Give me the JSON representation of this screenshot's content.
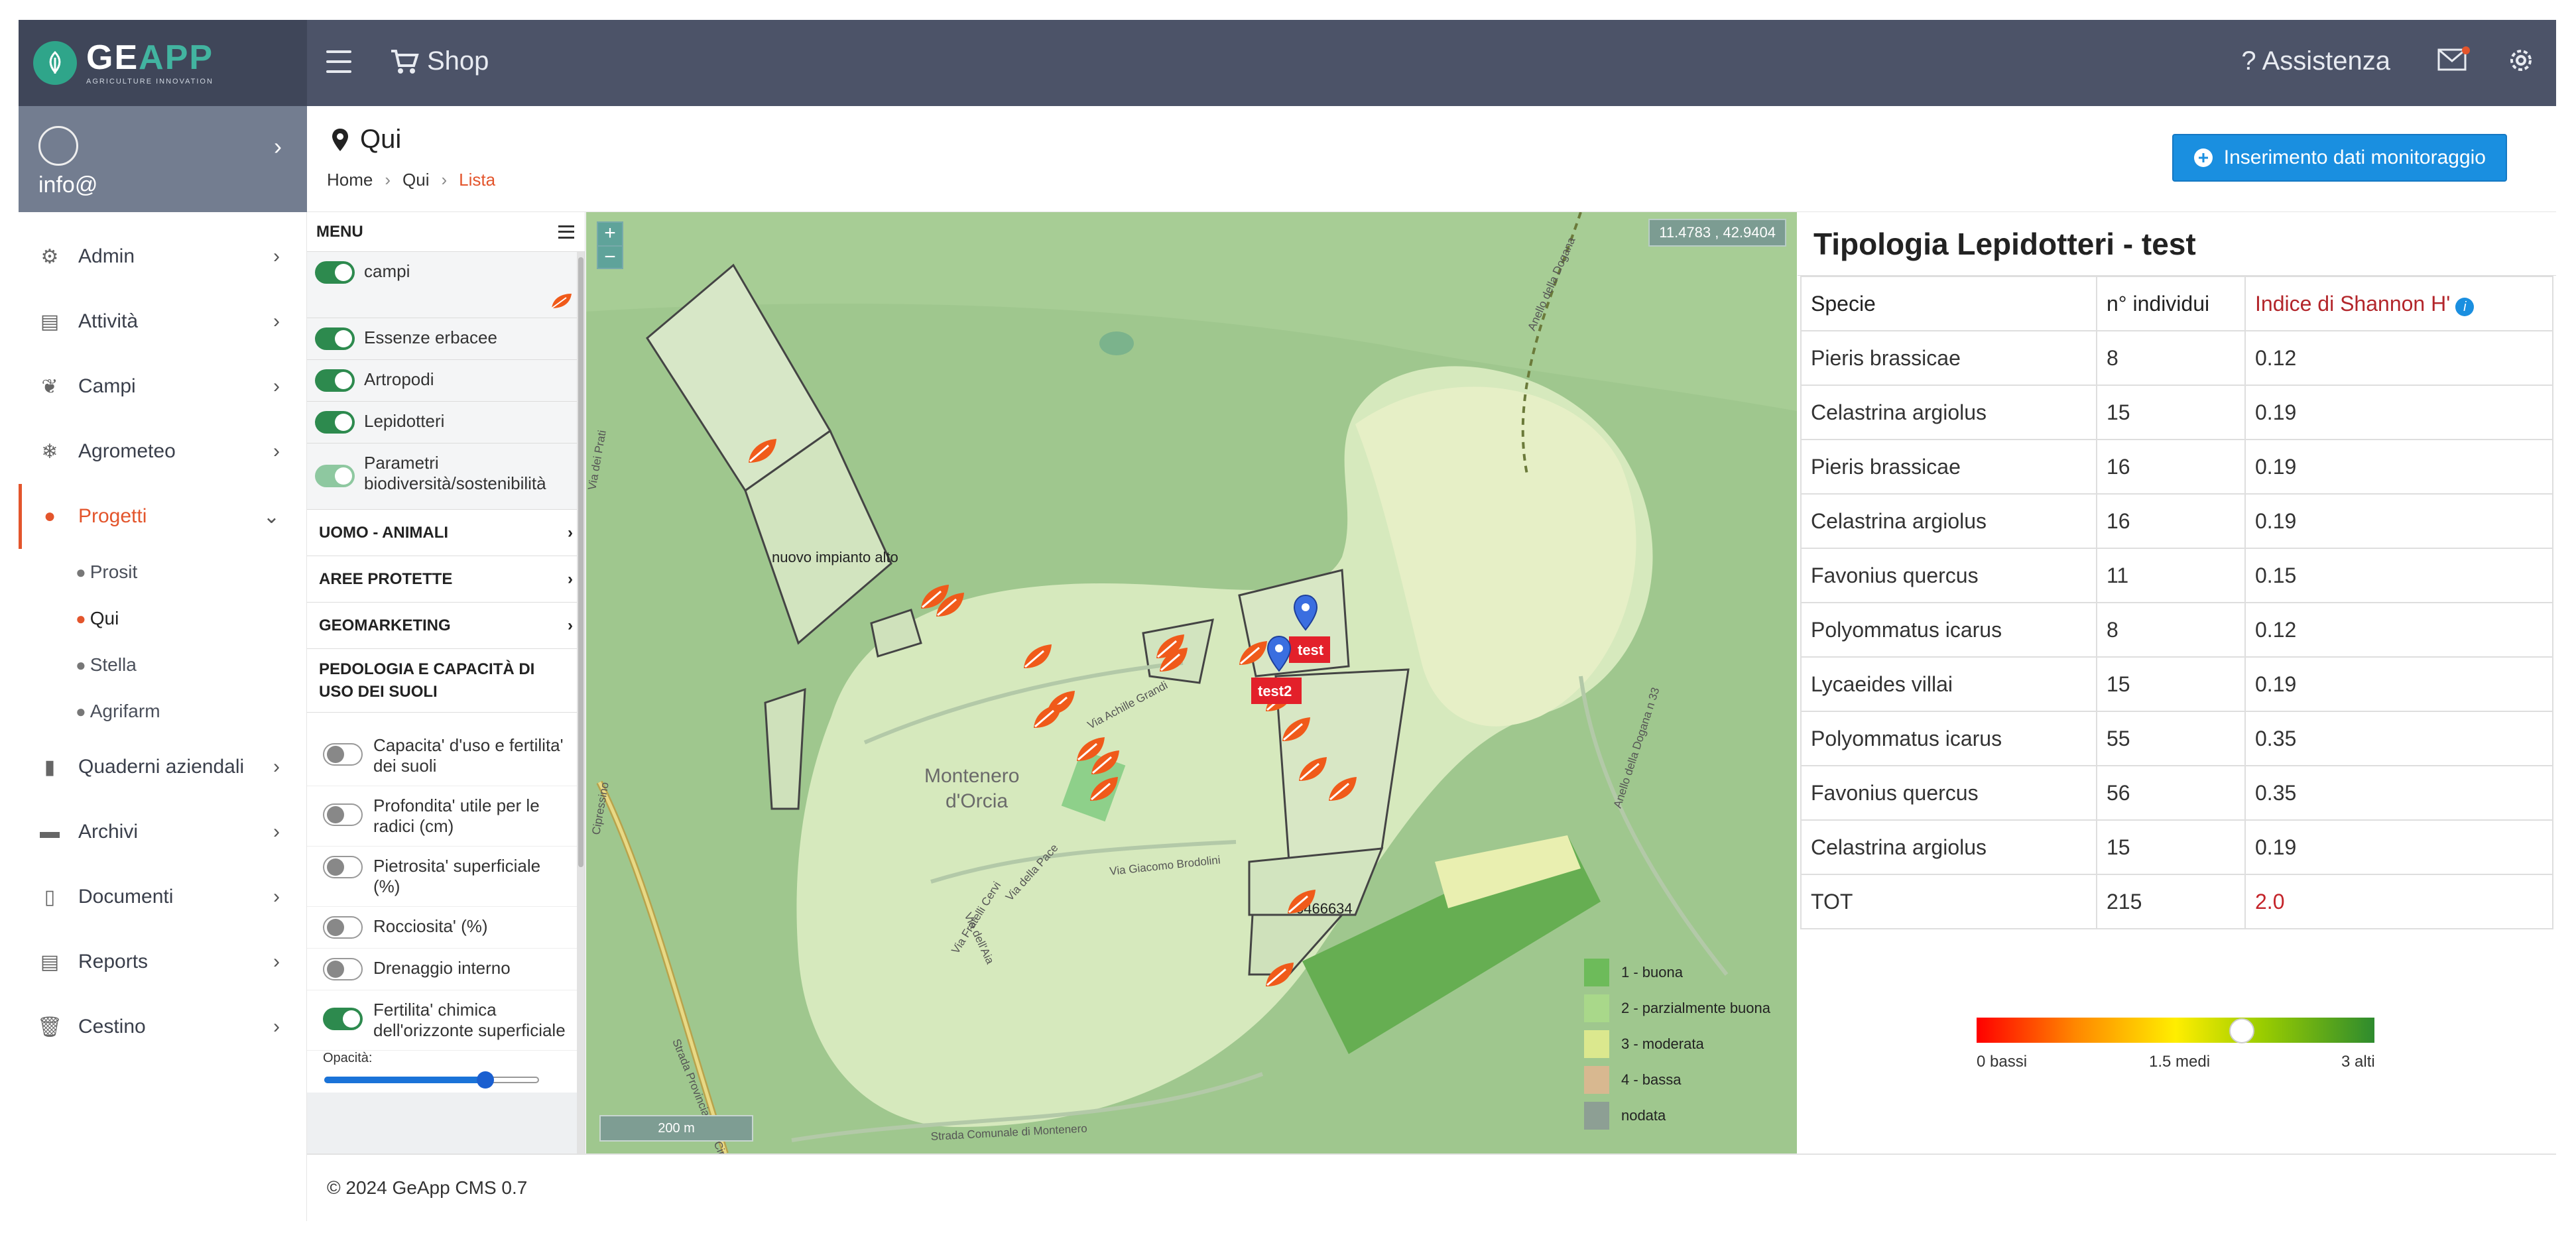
{
  "brand": {
    "name_left": "GE",
    "name_right": "APP",
    "tagline": "AGRICULTURE INNOVATION"
  },
  "topbar": {
    "shop": "Shop",
    "help": "Assistenza",
    "icons": [
      "menu-icon",
      "cart-icon",
      "question-icon",
      "mail-icon",
      "gear-icon"
    ]
  },
  "user": {
    "name": "info@"
  },
  "sidebar": {
    "items": [
      {
        "label": "Admin",
        "icon": "gear-icon"
      },
      {
        "label": "Attività",
        "icon": "clipboard-icon"
      },
      {
        "label": "Campi",
        "icon": "leaf-icon"
      },
      {
        "label": "Agrometeo",
        "icon": "snowflake-icon"
      },
      {
        "label": "Progetti",
        "icon": "pin-icon"
      },
      {
        "label": "Quaderni aziendali",
        "icon": "book-icon"
      },
      {
        "label": "Archivi",
        "icon": "archive-icon"
      },
      {
        "label": "Documenti",
        "icon": "document-icon"
      },
      {
        "label": "Reports",
        "icon": "report-icon"
      },
      {
        "label": "Cestino",
        "icon": "trash-icon"
      }
    ],
    "subitems": [
      "Prosit",
      "Qui",
      "Stella",
      "Agrifarm"
    ]
  },
  "page": {
    "title": "Qui",
    "breadcrumb": [
      "Home",
      "Qui",
      "Lista"
    ],
    "primary_button": "Inserimento dati monitoraggio"
  },
  "layers": {
    "menu_title": "MENU",
    "toggles": [
      "campi",
      "Essenze erbacee",
      "Artropodi",
      "Lepidotteri",
      "Parametri biodiversità/sostenibilità"
    ],
    "sections": [
      "UOMO - ANIMALI",
      "AREE PROTETTE",
      "GEOMARKETING",
      "PEDOLOGIA E CAPACITÀ DI USO DEI SUOLI"
    ],
    "soil_layers": [
      "Capacita' d'uso e fertilita' dei suoli",
      "Profondita' utile per le radici (cm)",
      "Pietrosita' superficiale (%)",
      "Rocciosita' (%)",
      "Drenaggio interno",
      "Fertilita' chimica dell'orizzonte superficiale"
    ],
    "opacity_label": "Opacità:",
    "opacity_value": 0.75
  },
  "map": {
    "coordinates": "11.4783 , 42.9404",
    "scale": "200 m",
    "zoom_in": "+",
    "zoom_out": "−",
    "labels": {
      "place": "Montenero\nd'Orcia",
      "place_line1": "Montenero",
      "place_line2": "d'Orcia",
      "field_name": "nuovo impianto alto",
      "field_id": "6466634",
      "marker1": "test",
      "marker2": "test2",
      "road1": "Via Achille Grandi",
      "road2": "Via Giacomo Brodolini",
      "road3": "Strada Provinciale 64 Cipressino",
      "road4": "Strada Comunale di Montenero",
      "road5": "Anello della Dogana",
      "road6": "Via Fratelli Cervi",
      "road7": "Via della Pace",
      "road8": "Via dell'Aia",
      "road9": "Anello della Dogana n 33",
      "road10": "Cipressino",
      "road11": "Via dei Prati"
    },
    "legend": [
      {
        "label": "1 - buona",
        "color": "#6dbb5a"
      },
      {
        "label": "2 - parzialmente buona",
        "color": "#a9d88a"
      },
      {
        "label": "3 - moderata",
        "color": "#dbe88e"
      },
      {
        "label": "4 - bassa",
        "color": "#d8b890"
      },
      {
        "label": "nodata",
        "color": "#8d9f94"
      }
    ]
  },
  "info": {
    "title": "Tipologia Lepidotteri - test",
    "headers": [
      "Specie",
      "n° individui",
      "Indice di Shannon H'"
    ],
    "rows": [
      [
        "Pieris brassicae",
        "8",
        "0.12"
      ],
      [
        "Celastrina argiolus",
        "15",
        "0.19"
      ],
      [
        "Pieris brassicae",
        "16",
        "0.19"
      ],
      [
        "Celastrina argiolus",
        "16",
        "0.19"
      ],
      [
        "Favonius quercus",
        "11",
        "0.15"
      ],
      [
        "Polyommatus icarus",
        "8",
        "0.12"
      ],
      [
        "Lycaeides villai",
        "15",
        "0.19"
      ],
      [
        "Polyommatus icarus",
        "55",
        "0.35"
      ],
      [
        "Favonius quercus",
        "56",
        "0.35"
      ],
      [
        "Celastrina argiolus",
        "15",
        "0.19"
      ]
    ],
    "total": [
      "TOT",
      "215",
      "2.0"
    ],
    "scale_labels": [
      "0 bassi",
      "1.5 medi",
      "3 alti"
    ],
    "scale_min": 0,
    "scale_max": 3,
    "scale_value": 2.0
  },
  "footer": {
    "text": "© 2024 GeApp CMS 0.7"
  }
}
